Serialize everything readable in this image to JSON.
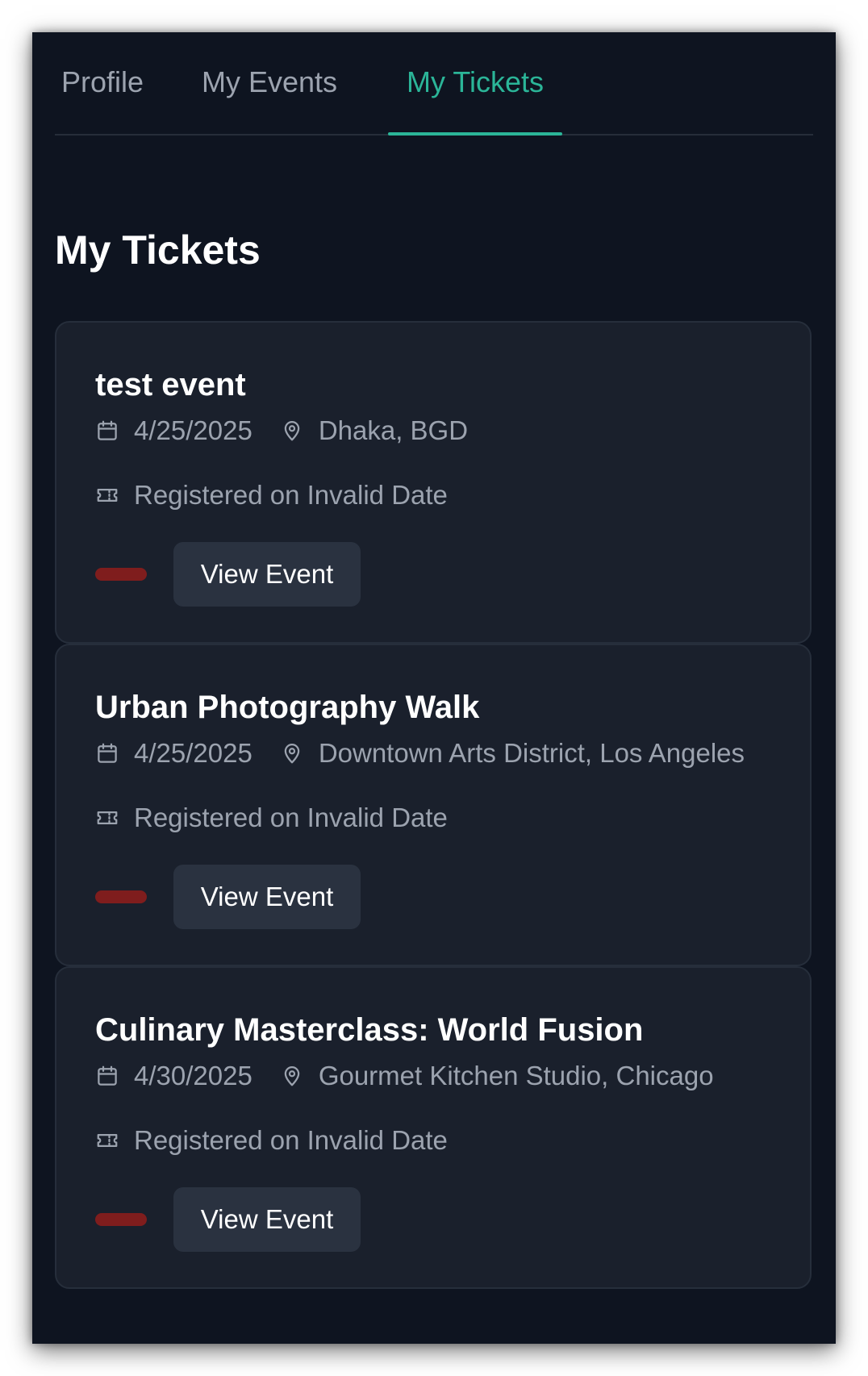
{
  "tabs": [
    {
      "label": "Profile"
    },
    {
      "label": "My Events"
    },
    {
      "label": "My Tickets",
      "active": true
    }
  ],
  "page_title": "My Tickets",
  "tickets": [
    {
      "title": "test event",
      "date": "4/25/2025",
      "location": "Dhaka, BGD",
      "registered": "Registered on Invalid Date",
      "button_label": "View Event"
    },
    {
      "title": "Urban Photography Walk",
      "date": "4/25/2025",
      "location": "Downtown Arts District, Los Angeles",
      "registered": "Registered on Invalid Date",
      "button_label": "View Event"
    },
    {
      "title": "Culinary Masterclass: World Fusion",
      "date": "4/30/2025",
      "location": "Gourmet Kitchen Studio, Chicago",
      "registered": "Registered on Invalid Date",
      "button_label": "View Event"
    }
  ],
  "colors": {
    "background": "#0e1420",
    "card": "#1a202c",
    "accent": "#2bb598",
    "status": "#7f1d1d",
    "button": "#2a3240",
    "muted_text": "#9ca3af"
  },
  "icons": {
    "date": "calendar-icon",
    "location": "map-pin-icon",
    "registered": "ticket-icon"
  }
}
